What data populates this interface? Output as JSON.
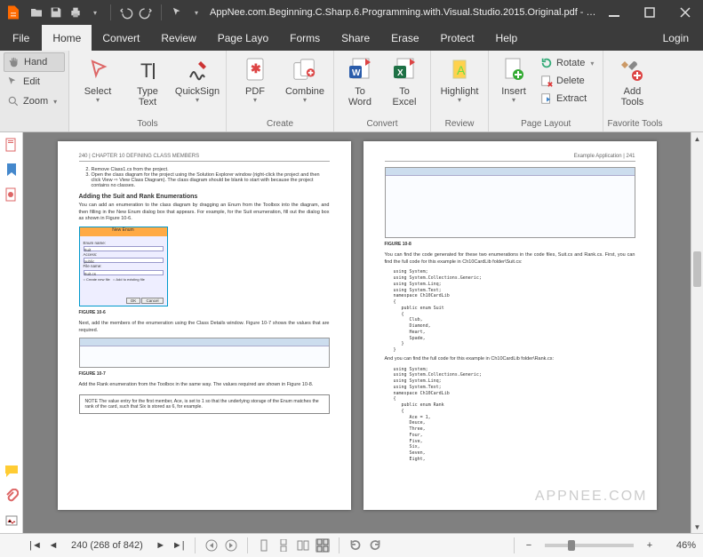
{
  "window": {
    "title": "AppNee.com.Beginning.C.Sharp.6.Programming.with.Visual.Studio.2015.Original.pdf - Ni..."
  },
  "menu": {
    "file": "File",
    "tabs": [
      "Home",
      "Convert",
      "Review",
      "Page Layo",
      "Forms",
      "Share",
      "Erase",
      "Protect",
      "Help"
    ],
    "active": 0,
    "login": "Login"
  },
  "viewtools": {
    "hand": "Hand",
    "edit": "Edit",
    "zoom": "Zoom"
  },
  "ribbon": {
    "tools": {
      "label": "Tools",
      "select": "Select",
      "typetext": "Type\nText",
      "quicksign": "QuickSign"
    },
    "create": {
      "label": "Create",
      "pdf": "PDF",
      "combine": "Combine"
    },
    "convert": {
      "label": "Convert",
      "word": "To\nWord",
      "excel": "To\nExcel"
    },
    "review": {
      "label": "Review",
      "highlight": "Highlight"
    },
    "pagelayout": {
      "label": "Page Layout",
      "insert": "Insert",
      "rotate": "Rotate",
      "delete": "Delete",
      "extract": "Extract"
    },
    "favorite": {
      "label": "Favorite Tools",
      "add": "Add\nTools"
    }
  },
  "doc_tab": {
    "title": "AppNee.com.Beginning.C.Sharp.6.Pr..."
  },
  "page_left": {
    "header_left": "240  |  CHAPTER 10   DEFINING CLASS MEMBERS",
    "step2": "Remove Class1.cs from the project.",
    "step3": "Open the class diagram for the project using the Solution Explorer window (right-click the project and then click View ⇨ View Class Diagram). The class diagram should be blank to start with because the project contains no classes.",
    "h1": "Adding the Suit and Rank Enumerations",
    "p1": "You can add an enumeration to the class diagram by dragging an Enum from the Toolbox into the diagram, and then filling in the New Enum dialog box that appears. For example, for the Suit enumeration, fill out the dialog box as shown in Figure 10-6.",
    "fc1": "FIGURE 10-6",
    "p2": "Next, add the members of the enumeration using the Class Details window. Figure 10-7 shows the values that are required.",
    "fc2": "FIGURE 10-7",
    "p3": "Add the Rank enumeration from the Toolbox in the same way. The values required are shown in Figure 10-8.",
    "note": "NOTE  The value entry for the first member, Ace, is set to 1 so that the underlying storage of the Enum matches the rank of the card, such that Six is stored as 6, for example."
  },
  "page_right": {
    "header_right": "Example Application  |  241",
    "fc3": "FIGURE 10-8",
    "p1": "You can find the code generated for these two enumerations in the code files, Suit.cs and Rank.cs. First, you can find the full code for this example in Ch10CardLib folder\\Suit.cs:",
    "code1": "using System;\nusing System.Collections.Generic;\nusing System.Linq;\nusing System.Text;\nnamespace Ch10CardLib\n{\n   public enum Suit\n   {\n      Club,\n      Diamond,\n      Heart,\n      Spade,\n   }\n}",
    "p2": "And you can find the full code for this example in Ch10CardLib folder\\Rank.cs:",
    "code2": "using System;\nusing System.Collections.Generic;\nusing System.Linq;\nusing System.Text;\nnamespace Ch10CardLib\n{\n   public enum Rank\n   {\n      Ace = 1,\n      Deuce,\n      Three,\n      Four,\n      Five,\n      Six,\n      Seven,\n      Eight,"
  },
  "watermark": "APPNEE.COM",
  "status": {
    "page_display": "240 (268 of 842)",
    "zoom": "46%"
  }
}
